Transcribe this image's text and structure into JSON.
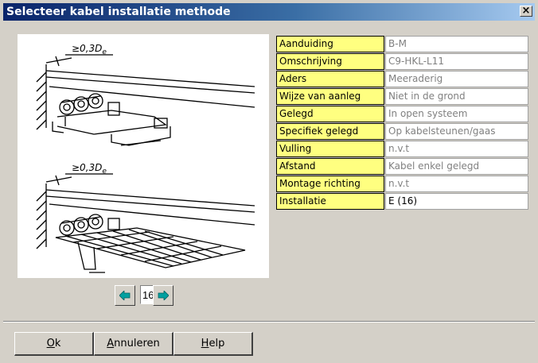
{
  "window": {
    "title": "Selecteer kabel installatie methode",
    "close_glyph": "×"
  },
  "picture": {
    "top_label_prefix": "≥0,3",
    "top_label_var": "D",
    "top_label_sub": "e",
    "bottom_label_prefix": "≥0,3",
    "bottom_label_var": "D",
    "bottom_label_sub": "e"
  },
  "stepper": {
    "value": "16",
    "prev_icon": "arrow-left-icon",
    "next_icon": "arrow-right-icon",
    "arrow_color": "#00a0a0"
  },
  "properties": [
    {
      "label": "Aanduiding",
      "value": "B-M"
    },
    {
      "label": "Omschrijving",
      "value": "C9-HKL-L11"
    },
    {
      "label": "Aders",
      "value": "Meeraderig"
    },
    {
      "label": "Wijze van aanleg",
      "value": "Niet in de grond"
    },
    {
      "label": "Gelegd",
      "value": "In open systeem"
    },
    {
      "label": "Specifiek gelegd",
      "value": "Op kabelsteunen/gaas"
    },
    {
      "label": "Vulling",
      "value": "n.v.t"
    },
    {
      "label": "Afstand",
      "value": "Kabel enkel gelegd"
    },
    {
      "label": "Montage richting",
      "value": "n.v.t"
    },
    {
      "label": "Installatie",
      "value": "E (16)"
    }
  ],
  "buttons": {
    "ok_hotkey": "O",
    "ok_rest": "k",
    "cancel_hotkey": "A",
    "cancel_rest": "nnuleren",
    "help_hotkey": "H",
    "help_rest": "elp"
  },
  "colors": {
    "title_start": "#0a246a",
    "title_end": "#a6caf0",
    "label_bg": "#ffff80",
    "dialog_bg": "#d4d0c8"
  }
}
